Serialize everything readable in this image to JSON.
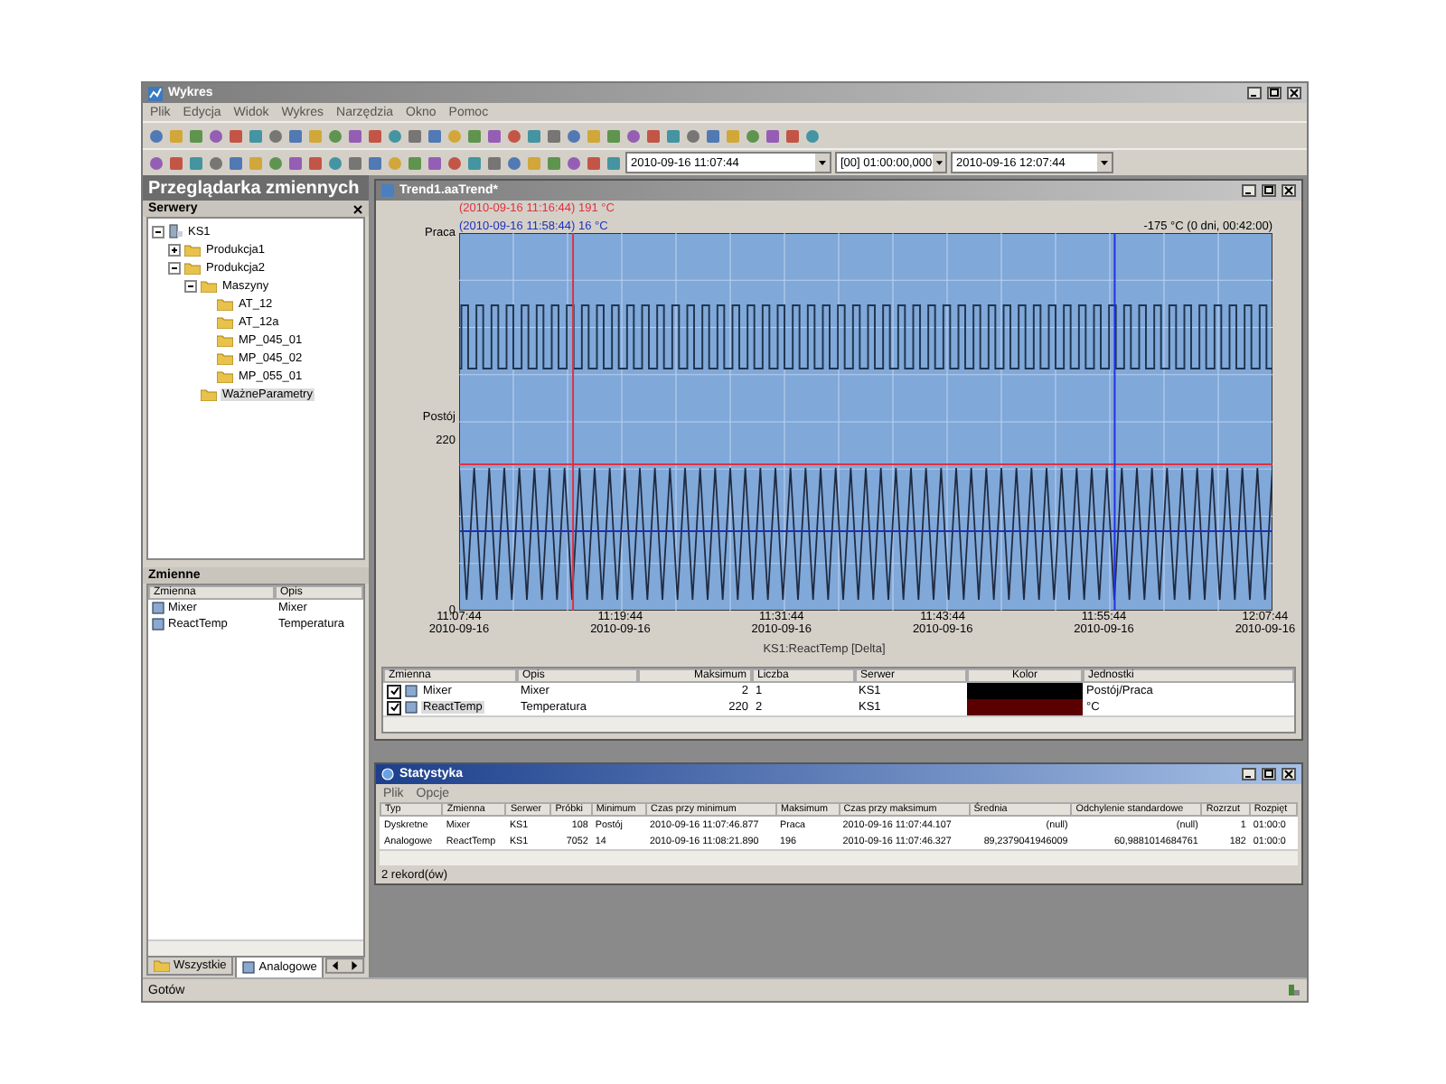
{
  "window": {
    "title": "Wykres"
  },
  "menu": [
    "Plik",
    "Edycja",
    "Widok",
    "Wykres",
    "Narzędzia",
    "Okno",
    "Pomoc"
  ],
  "time_range": {
    "start": "2010-09-16 11:07:44",
    "duration": "[00] 01:00:00,000",
    "end": "2010-09-16 12:07:44"
  },
  "browser": {
    "title": "Przeglądarka zmiennych",
    "servers_title": "Serwery",
    "tree": [
      {
        "label": "KS1",
        "kind": "server",
        "expanded": true,
        "selected": false,
        "children": [
          {
            "label": "Produkcja1",
            "kind": "folder",
            "expanded": false,
            "selected": false
          },
          {
            "label": "Produkcja2",
            "kind": "folder",
            "expanded": true,
            "selected": false,
            "children": [
              {
                "label": "Maszyny",
                "kind": "folder",
                "expanded": true,
                "selected": false,
                "children": [
                  {
                    "label": "AT_12",
                    "kind": "folder",
                    "selected": false
                  },
                  {
                    "label": "AT_12a",
                    "kind": "folder",
                    "selected": false
                  },
                  {
                    "label": "MP_045_01",
                    "kind": "folder",
                    "selected": false
                  },
                  {
                    "label": "MP_045_02",
                    "kind": "folder",
                    "selected": false
                  },
                  {
                    "label": "MP_055_01",
                    "kind": "folder",
                    "selected": false
                  }
                ]
              },
              {
                "label": "WażneParametry",
                "kind": "folder",
                "selected": true
              }
            ]
          }
        ]
      }
    ],
    "variables_title": "Zmienne",
    "variables_columns": [
      "Zmienna",
      "Opis"
    ],
    "variables": [
      {
        "name": "Mixer",
        "description": "Mixer"
      },
      {
        "name": "ReactTemp",
        "description": "Temperatura"
      }
    ],
    "tabs": [
      {
        "label": "Wszystkie",
        "selected": false
      },
      {
        "label": "Analogowe",
        "selected": true
      }
    ]
  },
  "trend": {
    "title": "Trend1.aaTrend*",
    "cursor_red": "(2010-09-16 11:16:44) 191 °C",
    "cursor_blue": "(2010-09-16 11:58:44) 16 °C",
    "cursor_delta": "-175 °C (0 dni, 00:42:00)",
    "y_labels": [
      "Praca",
      "Postój",
      "220",
      "0"
    ],
    "x_ticks": [
      {
        "time": "11:07:44",
        "date": "2010-09-16"
      },
      {
        "time": "11:19:44",
        "date": "2010-09-16"
      },
      {
        "time": "11:31:44",
        "date": "2010-09-16"
      },
      {
        "time": "11:43:44",
        "date": "2010-09-16"
      },
      {
        "time": "11:55:44",
        "date": "2010-09-16"
      },
      {
        "time": "12:07:44",
        "date": "2010-09-16"
      }
    ],
    "axis_title": "KS1:ReactTemp [Delta]",
    "legend": {
      "columns": [
        "Zmienna",
        "Opis",
        "Maksimum",
        "Liczba",
        "Serwer",
        "Kolor",
        "Jednostki"
      ],
      "rows": [
        {
          "checked": true,
          "name": "Mixer",
          "description": "Mixer",
          "maximum": "2",
          "count": "1",
          "server": "KS1",
          "color": "#000000",
          "units": "Postój/Praca",
          "selected": false
        },
        {
          "checked": true,
          "name": "ReactTemp",
          "description": "Temperatura",
          "maximum": "220",
          "count": "2",
          "server": "KS1",
          "color": "#5a0000",
          "units": "°C",
          "selected": true
        }
      ]
    }
  },
  "statistics": {
    "title": "Statystyka",
    "menu": [
      "Plik",
      "Opcje"
    ],
    "columns": [
      "Typ",
      "Zmienna",
      "Serwer",
      "Próbki",
      "Minimum",
      "Czas przy minimum",
      "Maksimum",
      "Czas przy maksimum",
      "Średnia",
      "Odchylenie standardowe",
      "Rozrzut",
      "Rozpięt"
    ],
    "rows": [
      [
        "Dyskretne",
        "Mixer",
        "KS1",
        "108",
        "Postój",
        "2010-09-16 11:07:46.877",
        "Praca",
        "2010-09-16 11:07:44.107",
        "(null)",
        "(null)",
        "1",
        "01:00:0"
      ],
      [
        "Analogowe",
        "ReactTemp",
        "KS1",
        "7052",
        "14",
        "2010-09-16 11:08:21.890",
        "196",
        "2010-09-16 11:07:46.327",
        "89,2379041946009",
        "60,9881014684761",
        "182",
        "01:00:0"
      ]
    ],
    "footer": "2 rekord(ów)"
  },
  "status_bar": "Gotów"
}
